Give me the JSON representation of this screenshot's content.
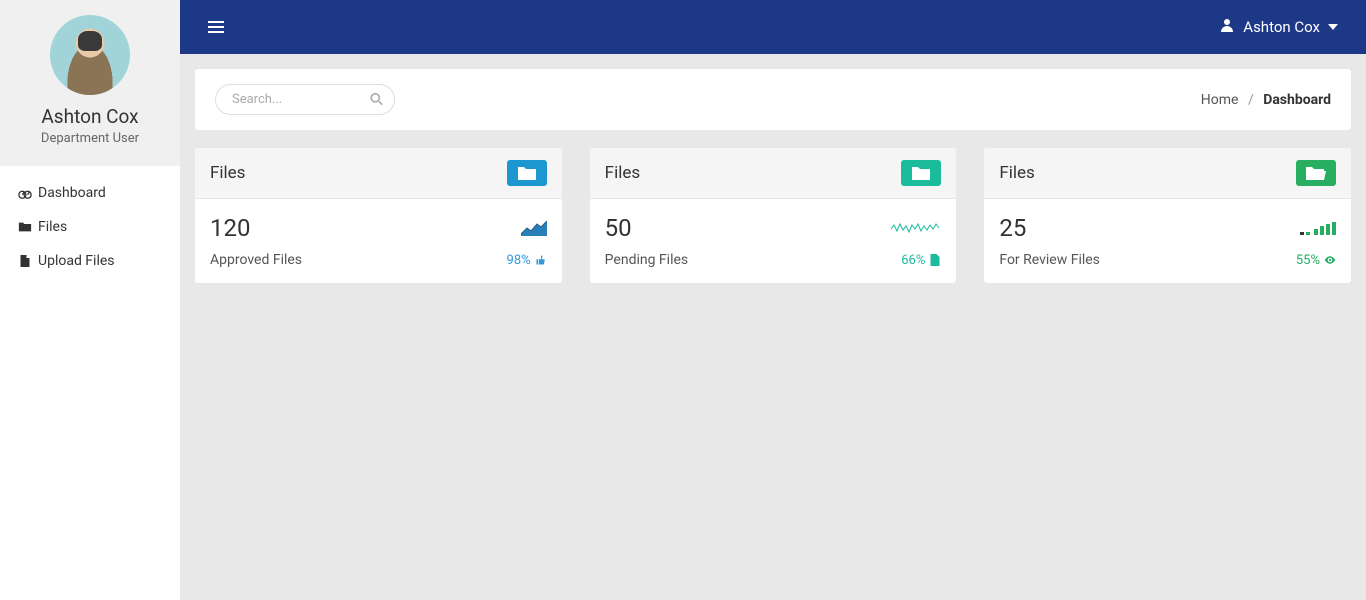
{
  "profile": {
    "name": "Ashton Cox",
    "role": "Department User"
  },
  "nav": {
    "dashboard": "Dashboard",
    "files": "Files",
    "upload": "Upload Files"
  },
  "topbar": {
    "user_name": "Ashton Cox"
  },
  "search": {
    "placeholder": "Search..."
  },
  "breadcrumb": {
    "home": "Home",
    "sep": "/",
    "current": "Dashboard"
  },
  "cards": [
    {
      "title": "Files",
      "value": "120",
      "label": "Approved Files",
      "pct": "98%",
      "color": "blue",
      "icon": "thumb"
    },
    {
      "title": "Files",
      "value": "50",
      "label": "Pending Files",
      "pct": "66%",
      "color": "teal",
      "icon": "file"
    },
    {
      "title": "Files",
      "value": "25",
      "label": "For Review Files",
      "pct": "55%",
      "color": "green",
      "icon": "eye"
    }
  ]
}
